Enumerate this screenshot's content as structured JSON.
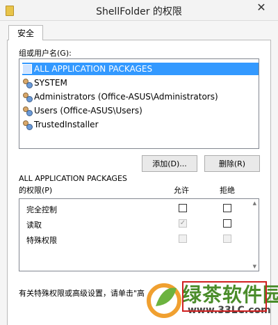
{
  "window": {
    "title": "ShellFolder 的权限",
    "close_glyph": "✕"
  },
  "tabs": [
    {
      "label": "安全"
    }
  ],
  "groups": {
    "label": "组或用户名(G):",
    "items": [
      {
        "name": "ALL APPLICATION PACKAGES",
        "selected": true
      },
      {
        "name": "SYSTEM",
        "selected": false
      },
      {
        "name": "Administrators (Office-ASUS\\Administrators)",
        "selected": false
      },
      {
        "name": "Users (Office-ASUS\\Users)",
        "selected": false
      },
      {
        "name": "TrustedInstaller",
        "selected": false
      }
    ]
  },
  "buttons": {
    "add": "添加(D)...",
    "remove": "删除(R)"
  },
  "permissions": {
    "header_principal": "ALL APPLICATION PACKAGES",
    "header_label": "的权限(P)",
    "col_allow": "允许",
    "col_deny": "拒绝",
    "rows": [
      {
        "name": "完全控制",
        "allow": false,
        "deny": false,
        "disabled": false,
        "allow_disabled": false
      },
      {
        "name": "读取",
        "allow": true,
        "deny": false,
        "disabled": false,
        "allow_disabled": true
      },
      {
        "name": "特殊权限",
        "allow": false,
        "deny": false,
        "disabled": true,
        "allow_disabled": true
      }
    ]
  },
  "footer": {
    "text": "有关特殊权限或高级设置，请单击\"高"
  },
  "watermark": {
    "main": "绿茶软件园",
    "url": "www.33LC.com"
  },
  "icons": {
    "user": "users-icon",
    "package": "package-icon",
    "folder": "folder-icon"
  }
}
